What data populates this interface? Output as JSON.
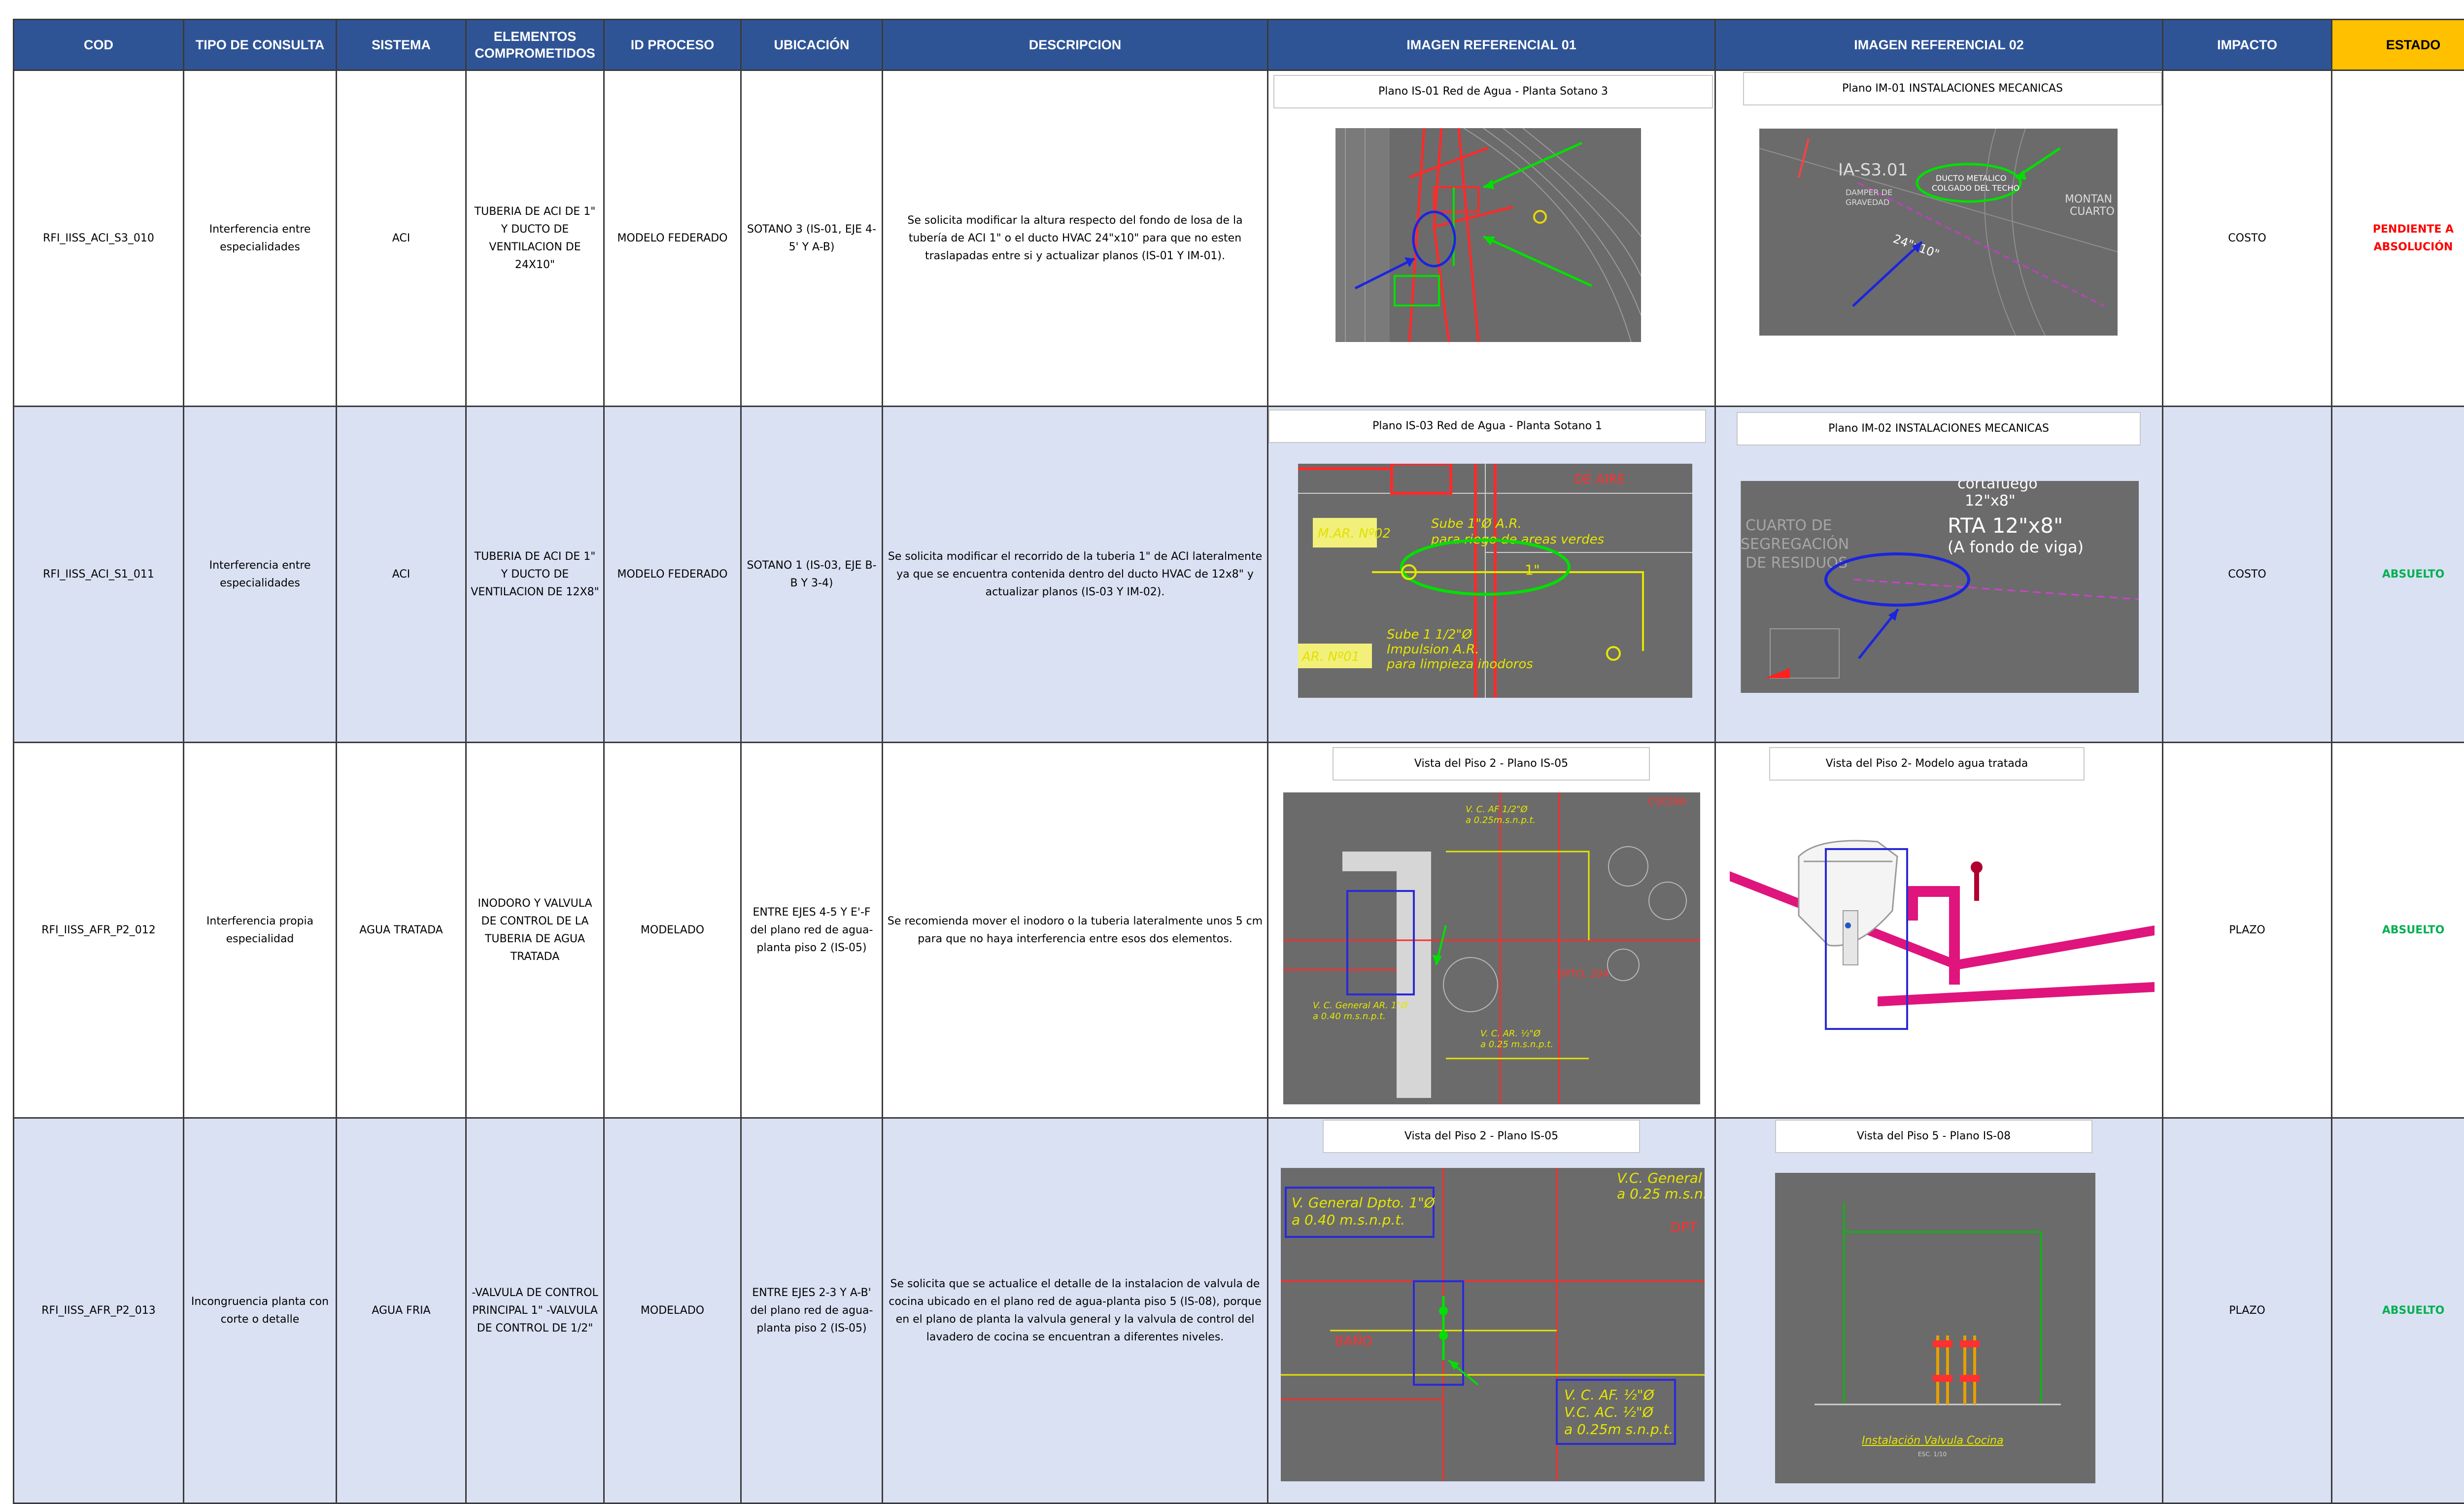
{
  "columns": [
    "COD",
    "TIPO DE CONSULTA",
    "SISTEMA",
    "ELEMENTOS COMPROMETIDOS",
    "ID PROCESO",
    "UBICACIÓN",
    "DESCRIPCION",
    "IMAGEN REFERENCIAL 01",
    "IMAGEN REFERENCIAL 02",
    "IMPACTO",
    "ESTADO"
  ],
  "status_colors": {
    "pending": "#ff0000",
    "resolved": "#00b050",
    "header": "#2f5496",
    "estado_header": "#ffc000",
    "row_shade": "#dae1f3"
  },
  "rows": [
    {
      "cod": "RFI_IISS_ACI_S3_010",
      "tipo": "Interferencia entre especialidades",
      "sistema": "ACI",
      "elementos": "TUBERIA DE ACI DE 1\" Y DUCTO DE VENTILACION DE 24X10\"",
      "proceso": "MODELO FEDERADO",
      "ubicacion": "SOTANO 3 (IS-01, EJE 4-5' Y A-B)",
      "descripcion": "Se solicita modificar la altura respecto del fondo de losa de la tubería de ACI 1\" o el ducto HVAC 24\"x10\" para que no esten traslapadas entre si y actualizar planos (IS-01 Y IM-01).",
      "img1_caption": "Plano IS-01 Red de Agua - Planta Sotano 3",
      "img2_caption": "Plano IM-01 INSTALACIONES MECANICAS",
      "img1_labels": {
        "a": "",
        "b": ""
      },
      "img2_labels": {
        "a": "IA-S3.01",
        "b": "DAMPER DE",
        "c": "GRAVEDAD",
        "d": "DUCTO METALICO",
        "e": "COLGADO DEL TECHO",
        "f": "24\"x10\"",
        "g": "MONTAN",
        "h": "CUARTO"
      },
      "impacto": "COSTO",
      "estado": "PENDIENTE A ABSOLUCIÓN"
    },
    {
      "cod": "RFI_IISS_ACI_S1_011",
      "tipo": "Interferencia entre especialidades",
      "sistema": "ACI",
      "elementos": "TUBERIA DE ACI DE 1\" Y DUCTO DE VENTILACION DE 12X8\"",
      "proceso": "MODELO FEDERADO",
      "ubicacion": "SOTANO 1 (IS-03, EJE B-B Y 3-4)",
      "descripcion": "Se solicita modificar el recorrido de la tuberia 1\" de ACI lateralmente ya que se encuentra contenida dentro del ducto HVAC de 12x8\" y actualizar planos (IS-03 Y IM-02).",
      "img1_caption": "Plano IS-03 Red de Agua - Planta Sotano 1",
      "img2_caption": "Plano IM-02 INSTALACIONES MECANICAS",
      "img1_labels": {
        "a": "M.AR. Nº02",
        "b": "Sube 1\"Ø A.R.",
        "c": "para riego de areas verdes",
        "d": "Sube 1 1/2\"Ø",
        "e": "Impulsion A.R.",
        "f": "para limpieza inodoros",
        "g": "AR. Nº01",
        "h": "DE AIRE",
        "i": "1\""
      },
      "img2_labels": {
        "a": "cortafuego",
        "b": "12\"x8\"",
        "c": "RTA 12\"x8\"",
        "d": "(A fondo de viga)",
        "e": "CUARTO DE",
        "f": "SEGREGACIÓN",
        "g": "DE RESIDUOS"
      },
      "impacto": "COSTO",
      "estado": "ABSUELTO"
    },
    {
      "cod": "RFI_IISS_AFR_P2_012",
      "tipo": "Interferencia propia especialidad",
      "sistema": "AGUA TRATADA",
      "elementos": "INODORO Y VALVULA DE CONTROL DE LA TUBERIA DE AGUA TRATADA",
      "proceso": "MODELADO",
      "ubicacion": "ENTRE EJES 4-5 Y E'-F del plano red de agua-planta piso 2 (IS-05)",
      "descripcion": "Se recomienda mover el inodoro o la tuberia lateralmente unos 5 cm para que no haya interferencia entre esos dos elementos.",
      "img1_caption": "Vista del Piso 2 - Plano IS-05",
      "img2_caption": "Vista del Piso 2- Modelo agua tratada",
      "img1_labels": {
        "a": "V. C. AF 1/2\"Ø",
        "b": "a 0.25m.s.n.p.t.",
        "c": "V. C. General AR. 1\"Ø",
        "d": "a 0.40 m.s.n.p.t.",
        "e": "V. C. AR. ½\"Ø",
        "f": "a 0.25 m.s.n.p.t.",
        "g": "DPTO. 204",
        "h": "COCINA"
      },
      "img2_labels": {},
      "impacto": "PLAZO",
      "estado": "ABSUELTO"
    },
    {
      "cod": "RFI_IISS_AFR_P2_013",
      "tipo": "Incongruencia planta con corte o detalle",
      "sistema": "AGUA FRIA",
      "elementos": "-VALVULA DE CONTROL PRINCIPAL 1\" -VALVULA DE CONTROL DE 1/2\"",
      "proceso": "MODELADO",
      "ubicacion": "ENTRE EJES 2-3 Y A-B' del plano red de agua-planta piso 2 (IS-05)",
      "descripcion": "Se solicita que se actualice el detalle de la instalacion de valvula de cocina ubicado en el plano red de agua-planta piso 5 (IS-08), porque en el plano de planta la valvula general y la valvula de control del lavadero de cocina se encuentran a diferentes niveles.",
      "img1_caption": "Vista del Piso 2 - Plano IS-05",
      "img2_caption": "Vista del Piso 5 - Plano IS-08",
      "img1_labels": {
        "a": "V. General Dpto. 1\"Ø",
        "b": "a 0.40 m.s.n.p.t.",
        "c": "V.C. General",
        "d": "a 0.25 m.s.n.",
        "e": "V. C. AF. ½\"Ø",
        "f": "V.C. AC. ½\"Ø",
        "g": "a 0.25m s.n.p.t.",
        "h": "DPT",
        "i": "BAÑO"
      },
      "img2_labels": {
        "a": "Instalación Valvula Cocina",
        "b": "ESC. 1/10"
      },
      "impacto": "PLAZO",
      "estado": "ABSUELTO"
    }
  ]
}
